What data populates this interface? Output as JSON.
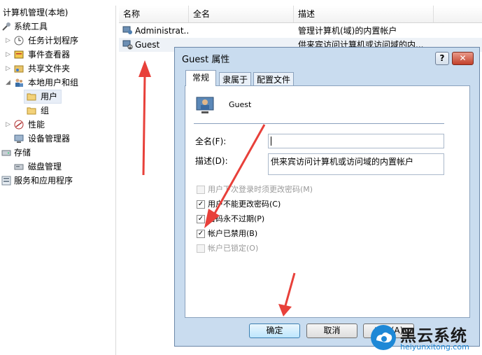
{
  "tree": {
    "root": "计算机管理(本地)",
    "items": [
      {
        "label": "系统工具",
        "icon": "tools-icon"
      },
      {
        "label": "任务计划程序",
        "icon": "clock-icon"
      },
      {
        "label": "事件查看器",
        "icon": "event-viewer-icon"
      },
      {
        "label": "共享文件夹",
        "icon": "shared-folder-icon"
      },
      {
        "label": "本地用户和组",
        "icon": "users-group-icon"
      },
      {
        "label": "用户",
        "icon": "folder-icon"
      },
      {
        "label": "组",
        "icon": "folder-icon"
      },
      {
        "label": "性能",
        "icon": "performance-icon"
      },
      {
        "label": "设备管理器",
        "icon": "device-manager-icon"
      },
      {
        "label": "存储",
        "icon": "storage-icon"
      },
      {
        "label": "磁盘管理",
        "icon": "disk-icon"
      },
      {
        "label": "服务和应用程序",
        "icon": "services-icon"
      }
    ]
  },
  "list": {
    "columns": [
      "名称",
      "全名",
      "描述"
    ],
    "rows": [
      {
        "name": "Administrat...",
        "fullname": "",
        "desc": "管理计算机(域)的内置帐户"
      },
      {
        "name": "Guest",
        "fullname": "",
        "desc": "供来宾访问计算机或访问域的内..."
      }
    ]
  },
  "dialog": {
    "title": "Guest 属性",
    "help": "?",
    "close": "✕",
    "tabs": [
      "常规",
      "隶属于",
      "配置文件"
    ],
    "username": "Guest",
    "fullname_label": "全名(F):",
    "fullname_value": "",
    "desc_label": "描述(D):",
    "desc_value": "供来宾访问计算机或访问域的内置帐户",
    "checks": [
      {
        "label": "用户下次登录时须更改密码(M)",
        "checked": false,
        "disabled": true
      },
      {
        "label": "用户不能更改密码(C)",
        "checked": true,
        "disabled": false
      },
      {
        "label": "密码永不过期(P)",
        "checked": true,
        "disabled": false
      },
      {
        "label": "帐户已禁用(B)",
        "checked": true,
        "disabled": false
      },
      {
        "label": "帐户已锁定(O)",
        "checked": false,
        "disabled": true
      }
    ],
    "ok": "确定",
    "cancel": "取消",
    "apply": "应用(A)"
  },
  "watermark": {
    "title": "黑云系统",
    "url": "heiyunxitong.com"
  },
  "colors": {
    "arrow": "#e8403a",
    "dialog_bg": "#c9dcef",
    "watermark_blue": "#1e88d6"
  }
}
